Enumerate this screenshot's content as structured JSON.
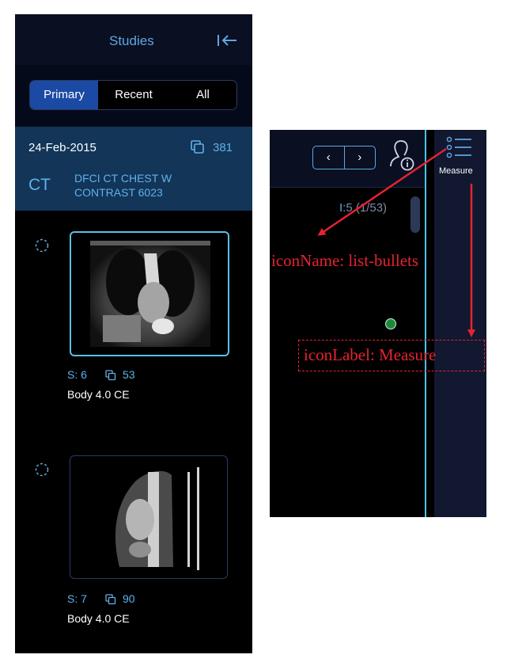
{
  "studies_panel": {
    "title": "Studies",
    "tabs": [
      "Primary",
      "Recent",
      "All"
    ],
    "active_tab": "Primary",
    "study": {
      "date": "24-Feb-2015",
      "instance_count": "381",
      "modality": "CT",
      "description": "DFCI CT CHEST W CONTRAST 6023"
    },
    "series": [
      {
        "s_label": "S:",
        "number": "6",
        "count": "53",
        "name": "Body 4.0 CE"
      },
      {
        "s_label": "S:",
        "number": "7",
        "count": "90",
        "name": "Body 4.0 CE"
      }
    ]
  },
  "viewport": {
    "prev_glyph": "‹",
    "next_glyph": "›",
    "image_index_prefix": "I:",
    "image_index": "5 (1/53)"
  },
  "toolbar": {
    "measure_label": "Measure",
    "measure_icon": "list-bullets"
  },
  "annotations": {
    "icon_name": "iconName: list-bullets",
    "icon_label": "iconLabel: Measure",
    "color": "#e52330"
  },
  "colors": {
    "accent": "#5ea8e0",
    "active_tab": "#1b4aa4",
    "study_bg": "#123558",
    "thumb_border": "#58c1e6",
    "divider": "#4ec3e6"
  }
}
